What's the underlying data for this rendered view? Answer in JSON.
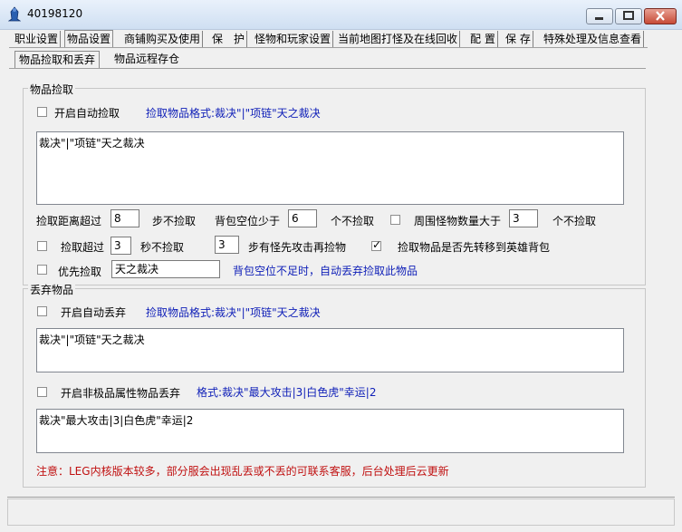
{
  "window": {
    "title": "40198120"
  },
  "tabs": [
    "职业设置",
    "物品设置",
    "商铺购买及使用",
    "保　护",
    "怪物和玩家设置",
    "当前地图打怪及在线回收",
    "配 置",
    "保 存",
    "特殊处理及信息查看"
  ],
  "subtabs": [
    "物品捡取和丢弃",
    "物品远程存仓"
  ],
  "pickup": {
    "legend": "物品捡取",
    "auto_label": "开启自动捡取",
    "format_hint": "捡取物品格式:裁决\"|\"项链\"天之裁决",
    "list_value": "裁决\"|\"项链\"天之裁决",
    "distance_label": "捡取距离超过",
    "distance_value": "8",
    "distance_suffix": "步不捡取",
    "bag_label": "背包空位少于",
    "bag_value": "6",
    "bag_suffix": "个不捡取",
    "monster_label": "周围怪物数量大于",
    "monster_value": "3",
    "monster_suffix": "个不捡取",
    "timeout_label": "捡取超过",
    "timeout_value": "3",
    "timeout_suffix": "秒不捡取",
    "attack_value": "3",
    "attack_suffix": "步有怪先攻击再捡物",
    "hero_bag_label": "捡取物品是否先转移到英雄背包",
    "priority_label": "优先捡取",
    "priority_value": "天之裁决",
    "priority_hint": "背包空位不足时，自动丢弃捡取此物品"
  },
  "drop": {
    "legend": "丢弃物品",
    "auto_label": "开启自动丢弃",
    "format_hint": "捡取物品格式:裁决\"|\"项链\"天之裁决",
    "list_value": "裁决\"|\"项链\"天之裁决",
    "attr_label": "开启非极品属性物品丢弃",
    "attr_hint": "格式:裁决\"最大攻击|3|白色虎\"幸运|2",
    "attr_value": "裁决\"最大攻击|3|白色虎\"幸运|2",
    "note": "注意：LEG内核版本较多，部分服会出现乱丢或不丢的可联系客服，后台处理后云更新"
  },
  "checkboxes": {
    "auto_pickup": false,
    "monster_count": false,
    "timeout": false,
    "hero_bag": true,
    "priority": false,
    "auto_drop": false,
    "attr_drop": false
  },
  "colors": {
    "hint_blue": "#1020b8",
    "note_red": "#c01010"
  }
}
